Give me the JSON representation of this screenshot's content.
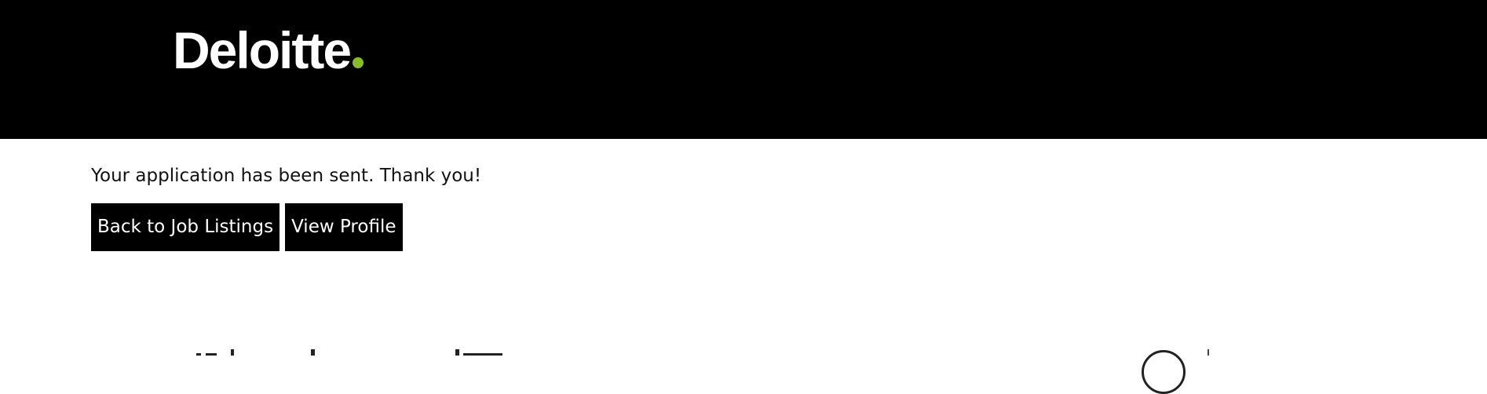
{
  "header": {
    "logo_text": "Deloitte",
    "logo_dot_color": "#86BC25",
    "background_color": "#000000"
  },
  "main": {
    "confirmation_message": "Your application has been sent. Thank you!",
    "buttons": {
      "back_label": "Back to Job Listings",
      "profile_label": "View Profile"
    }
  },
  "icons": {
    "partial_bottom_icon": "circle-icon"
  }
}
